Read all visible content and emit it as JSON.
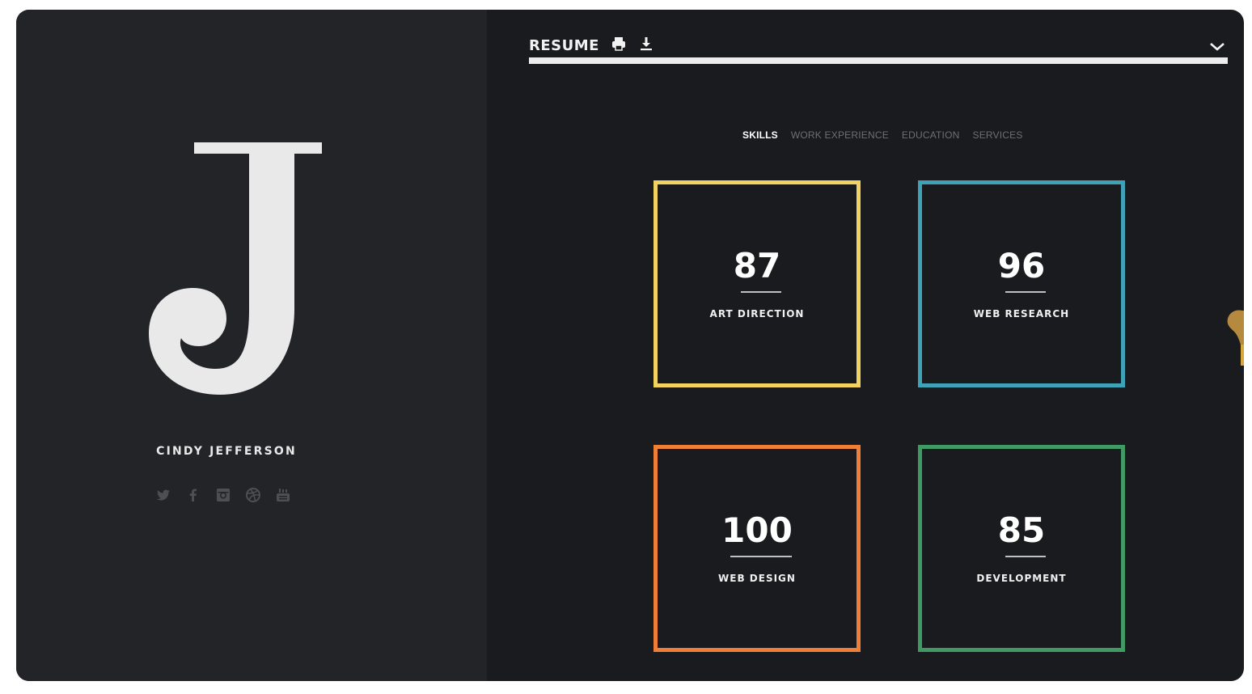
{
  "profile": {
    "monogram": "J",
    "name": "CINDY JEFFERSON",
    "social": [
      "twitter-icon",
      "facebook-icon",
      "instagram-icon",
      "dribbble-icon",
      "youtube-icon"
    ]
  },
  "header": {
    "title": "RESUME",
    "icons": [
      "print-icon",
      "download-icon",
      "chevron-down-icon"
    ]
  },
  "tabs": [
    {
      "label": "SKILLS",
      "active": true
    },
    {
      "label": "WORK EXPERIENCE",
      "active": false
    },
    {
      "label": "EDUCATION",
      "active": false
    },
    {
      "label": "SERVICES",
      "active": false
    }
  ],
  "skills": [
    {
      "value": "87",
      "label": "ART DIRECTION",
      "color": "#f2d35f"
    },
    {
      "value": "96",
      "label": "WEB RESEARCH",
      "color": "#3fa3b7"
    },
    {
      "value": "100",
      "label": "WEB DESIGN",
      "color": "#ef7f36"
    },
    {
      "value": "85",
      "label": "DEVELOPMENT",
      "color": "#3f9a63"
    }
  ],
  "colors": {
    "left_panel": "#232428",
    "right_panel": "#1a1b1e",
    "text": "#ffffff",
    "muted": "#6e6f73"
  }
}
